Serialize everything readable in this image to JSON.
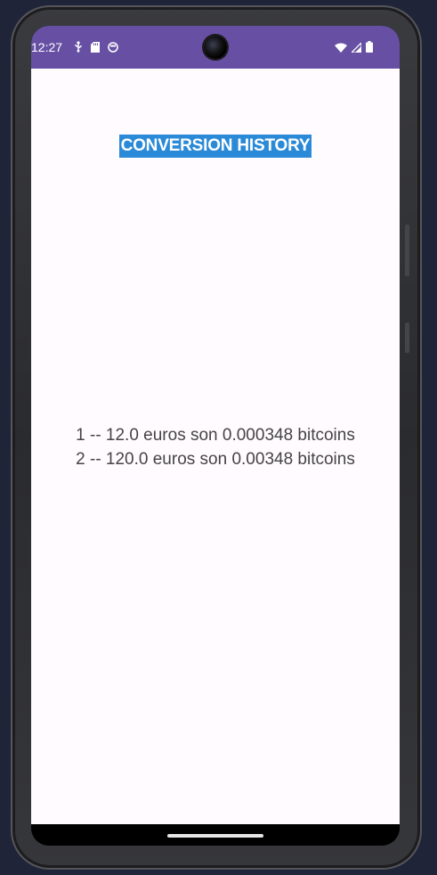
{
  "status_bar": {
    "time": "12:27",
    "background_color": "#6750a4",
    "left_icons": [
      "usb-debug-icon",
      "sd-card-icon",
      "app-notification-icon"
    ],
    "right_icons": [
      "wifi-icon",
      "cellular-signal-icon",
      "battery-icon"
    ]
  },
  "screen": {
    "title": "CONVERSION HISTORY",
    "title_background_color": "#2a8ad8",
    "history": [
      "1 -- 12.0 euros son 0.000348 bitcoins",
      "2 -- 120.0 euros son 0.00348 bitcoins"
    ]
  }
}
